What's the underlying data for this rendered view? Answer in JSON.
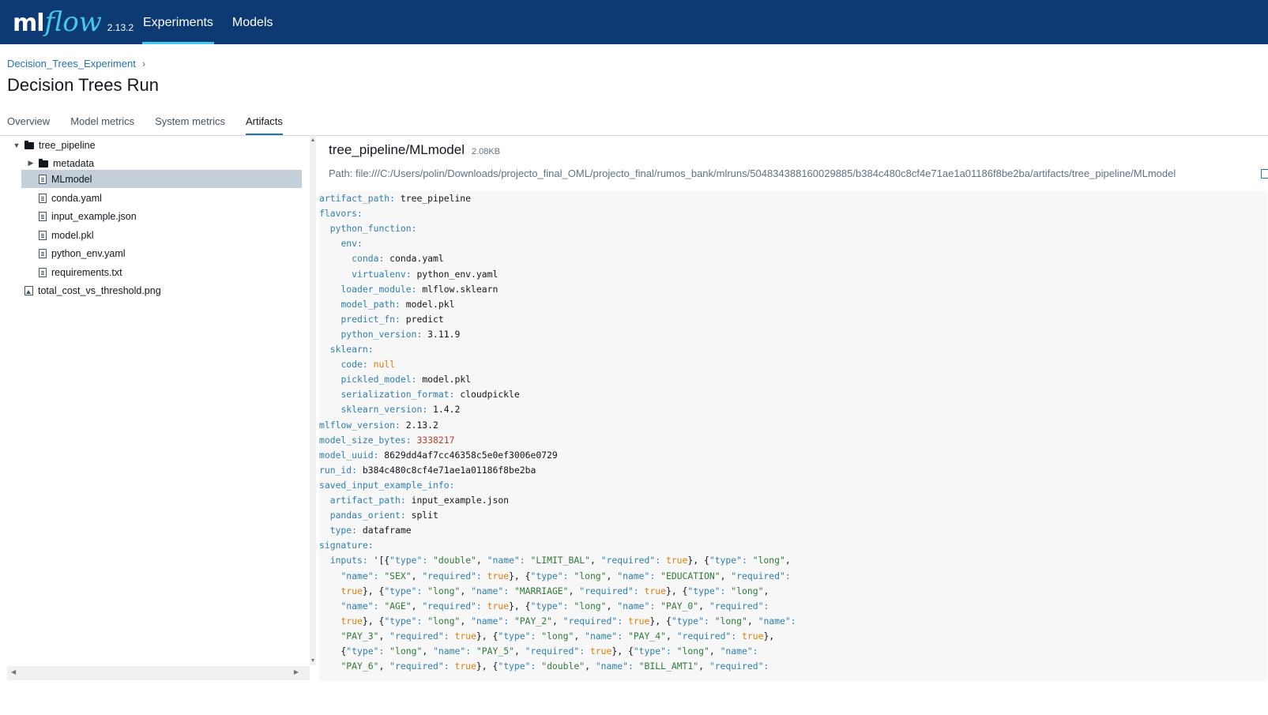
{
  "header": {
    "logo_ml": "ml",
    "logo_flow": "flow",
    "version": "2.13.2",
    "nav": [
      "Experiments",
      "Models"
    ]
  },
  "breadcrumb": {
    "experiment": "Decision_Trees_Experiment",
    "separator": "›"
  },
  "page_title": "Decision Trees Run",
  "tabs": [
    "Overview",
    "Model metrics",
    "System metrics",
    "Artifacts"
  ],
  "active_tab": "Artifacts",
  "tree": [
    {
      "label": "tree_pipeline",
      "icon": "folder-icon",
      "expanded": true
    },
    {
      "label": "metadata",
      "icon": "folder-icon",
      "expanded": false
    },
    {
      "label": "MLmodel",
      "icon": "file-icon",
      "selected": true
    },
    {
      "label": "conda.yaml",
      "icon": "file-icon"
    },
    {
      "label": "input_example.json",
      "icon": "file-icon"
    },
    {
      "label": "model.pkl",
      "icon": "file-icon"
    },
    {
      "label": "python_env.yaml",
      "icon": "file-icon"
    },
    {
      "label": "requirements.txt",
      "icon": "file-icon"
    },
    {
      "label": "total_cost_vs_threshold.png",
      "icon": "image-icon"
    }
  ],
  "file": {
    "name": "tree_pipeline/MLmodel",
    "size": "2.08KB",
    "path": "Path: file:///C:/Users/polin/Downloads/projecto_final_OML/projecto_final/rumos_bank/mlruns/504834388160029885/b384c480c8cf4e71ae1a01186f8be2ba/artifacts/tree_pipeline/MLmodel"
  },
  "yaml": [
    {
      "k": "artifact_path",
      "v": "tree_pipeline",
      "t": "s"
    },
    {
      "k": "flavors",
      "v": "",
      "t": "s"
    },
    {
      "k": "  python_function",
      "v": "",
      "t": "s"
    },
    {
      "k": "    env",
      "v": "",
      "t": "s"
    },
    {
      "k": "      conda",
      "v": "conda.yaml",
      "t": "s"
    },
    {
      "k": "      virtualenv",
      "v": "python_env.yaml",
      "t": "s"
    },
    {
      "k": "    loader_module",
      "v": "mlflow.sklearn",
      "t": "s"
    },
    {
      "k": "    model_path",
      "v": "model.pkl",
      "t": "s"
    },
    {
      "k": "    predict_fn",
      "v": "predict",
      "t": "s"
    },
    {
      "k": "    python_version",
      "v": "3.11.9",
      "t": "s"
    },
    {
      "k": "  sklearn",
      "v": "",
      "t": "s"
    },
    {
      "k": "    code",
      "v": "null",
      "t": "b"
    },
    {
      "k": "    pickled_model",
      "v": "model.pkl",
      "t": "s"
    },
    {
      "k": "    serialization_format",
      "v": "cloudpickle",
      "t": "s"
    },
    {
      "k": "    sklearn_version",
      "v": "1.4.2",
      "t": "s"
    },
    {
      "k": "mlflow_version",
      "v": "2.13.2",
      "t": "s"
    },
    {
      "k": "model_size_bytes",
      "v": "3338217",
      "t": "n"
    },
    {
      "k": "model_uuid",
      "v": "8629dd4af7cc46358c5e0ef3006e0729",
      "t": "s"
    },
    {
      "k": "run_id",
      "v": "b384c480c8cf4e71ae1a01186f8be2ba",
      "t": "s"
    },
    {
      "k": "saved_input_example_info",
      "v": "",
      "t": "s"
    },
    {
      "k": "  artifact_path",
      "v": "input_example.json",
      "t": "s"
    },
    {
      "k": "  pandas_orient",
      "v": "split",
      "t": "s"
    },
    {
      "k": "  type",
      "v": "dataframe",
      "t": "s"
    },
    {
      "k": "signature",
      "v": "",
      "t": "s"
    }
  ],
  "signature_lines": [
    "  inputs: '[{\"type\": \"double\", \"name\": \"LIMIT_BAL\", \"required\": true}, {\"type\": \"long\",",
    "    \"name\": \"SEX\", \"required\": true}, {\"type\": \"long\", \"name\": \"EDUCATION\", \"required\":",
    "    true}, {\"type\": \"long\", \"name\": \"MARRIAGE\", \"required\": true}, {\"type\": \"long\",",
    "    \"name\": \"AGE\", \"required\": true}, {\"type\": \"long\", \"name\": \"PAY_0\", \"required\":",
    "    true}, {\"type\": \"long\", \"name\": \"PAY_2\", \"required\": true}, {\"type\": \"long\", \"name\":",
    "    \"PAY_3\", \"required\": true}, {\"type\": \"long\", \"name\": \"PAY_4\", \"required\": true},",
    "    {\"type\": \"long\", \"name\": \"PAY_5\", \"required\": true}, {\"type\": \"long\", \"name\":",
    "    \"PAY_6\", \"required\": true}, {\"type\": \"double\", \"name\": \"BILL_AMT1\", \"required\":"
  ]
}
